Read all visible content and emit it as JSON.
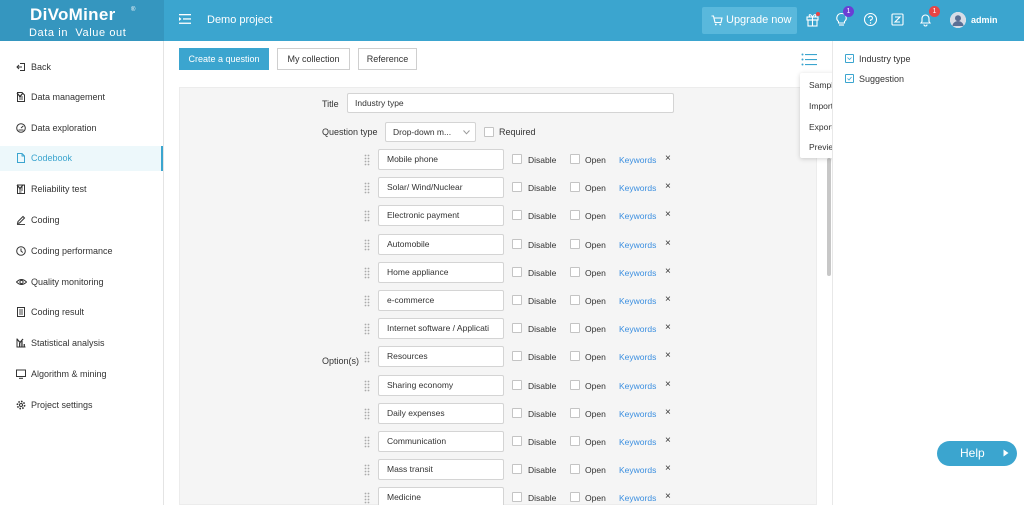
{
  "header": {
    "logo_text": "DiVoMiner",
    "logo_registered": "®",
    "logo_tagline": "Data in  Value out",
    "project_title": "Demo project",
    "upgrade_label": "Upgrade now",
    "tips_badge": "1",
    "notifications_badge": "1",
    "username": "admin",
    "icons": [
      "menu-toggle-icon",
      "cart-icon",
      "gift-icon",
      "lightbulb-icon",
      "help-circle-icon",
      "app-icon",
      "bell-icon",
      "avatar"
    ]
  },
  "sidebar": {
    "items": [
      {
        "label": "Back",
        "icon": "back-icon"
      },
      {
        "label": "Data management",
        "icon": "document-icon",
        "expandable": true
      },
      {
        "label": "Data exploration",
        "icon": "gauge-icon"
      },
      {
        "label": "Codebook",
        "icon": "book-icon",
        "active": true
      },
      {
        "label": "Reliability test",
        "icon": "clipboard-icon",
        "expandable": true
      },
      {
        "label": "Coding",
        "icon": "pencil-icon"
      },
      {
        "label": "Coding performance",
        "icon": "performance-icon"
      },
      {
        "label": "Quality monitoring",
        "icon": "eye-icon"
      },
      {
        "label": "Coding result",
        "icon": "list-doc-icon"
      },
      {
        "label": "Statistical analysis",
        "icon": "bar-chart-icon",
        "expandable": true
      },
      {
        "label": "Algorithm & mining",
        "icon": "monitor-icon"
      },
      {
        "label": "Project settings",
        "icon": "settings-icon"
      }
    ]
  },
  "toolbar": {
    "create_label": "Create a question",
    "collection_label": "My collection",
    "reference_label": "Reference"
  },
  "menu": {
    "items": [
      "Sample",
      "Import",
      "Export",
      "Preview"
    ]
  },
  "form": {
    "title_label": "Title",
    "title_value": "Industry type",
    "question_type_label": "Question type",
    "question_type_value": "Drop-down m...",
    "required_label": "Required",
    "options_label": "Option(s)",
    "disable_label": "Disable",
    "open_label": "Open",
    "keywords_label": "Keywords",
    "remove_symbol": "×",
    "options": [
      "Mobile phone",
      "Solar/ Wind/Nuclear",
      "Electronic payment",
      "Automobile",
      "Home appliance",
      "e-commerce",
      "Internet software / Applicati",
      "Resources",
      "Sharing economy",
      "Daily expenses",
      "Communication",
      "Mass transit",
      "Medicine"
    ]
  },
  "question_tree": {
    "items": [
      {
        "label": "Industry type",
        "checked": false
      },
      {
        "label": "Suggestion",
        "checked": false
      }
    ]
  },
  "help": {
    "label": "Help"
  },
  "colors": {
    "brand": "#3ba5cf",
    "logo_bg": "#3596bf",
    "link": "#3b8fe0",
    "badge_purple": "#6a3fd4",
    "badge_red": "#e84545"
  }
}
